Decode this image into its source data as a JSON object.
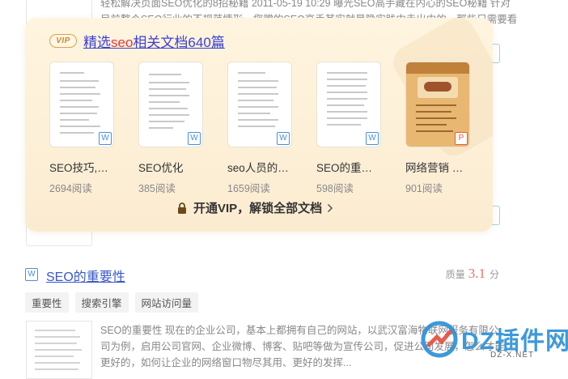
{
  "background": {
    "snippet_line1": "轻松解决页面SEO优化的8招秘籍 2011-05-19 10:29 曝光SEO高手藏在内心的SEO秘籍 针对",
    "snippet_line2": "目前整个SEO行业的不规范情形，您赠的SEO高手其实就是隐实践中走出中的，那些只需要看"
  },
  "vip_panel": {
    "badge": "VIP",
    "title_prefix": "精选",
    "title_keyword": "seo",
    "title_suffix": "相关文档640篇",
    "documents": [
      {
        "name": "SEO技巧,…",
        "reads": "2694阅读",
        "file_type": "W",
        "file_icon": "word-icon"
      },
      {
        "name": "SEO优化",
        "reads": "385阅读",
        "file_type": "W",
        "file_icon": "word-icon"
      },
      {
        "name": "seo人员的…",
        "reads": "1659阅读",
        "file_type": "W",
        "file_icon": "word-icon"
      },
      {
        "name": "SEO的重…",
        "reads": "598阅读",
        "file_type": "W",
        "file_icon": "word-icon"
      },
      {
        "name": "网络营销 …",
        "reads": "901阅读",
        "file_type": "P",
        "file_icon": "ppt-icon"
      }
    ],
    "unlock_label": "开通VIP，解锁全部文档"
  },
  "result": {
    "file_type": "W",
    "title": "SEO的重要性",
    "quality_label": "质量",
    "quality_score": "3.1",
    "quality_unit": "分",
    "tags": [
      "重要性",
      "搜索引擎",
      "网站访问量"
    ],
    "snippet": "SEO的重要性 现在的企业公司，基本上都拥有自己的网站，以武汉富海物联网服务有限公司为例，启用公司官网、企业微博、博客、贴吧等做为宣传公司，促进公司发展，怎么才能更好的，如何让企业的网络窗口物尽其用、更好的发挥..."
  },
  "watermark": {
    "brand": "DZ插件网",
    "url": "DZ-X.NET"
  },
  "colors": {
    "vip_gold": "#d9a250",
    "link_blue": "#3a59c9",
    "keyword_red": "#e4393c",
    "word_blue": "#4a8fdc",
    "ppt_red": "#e65a3c"
  }
}
